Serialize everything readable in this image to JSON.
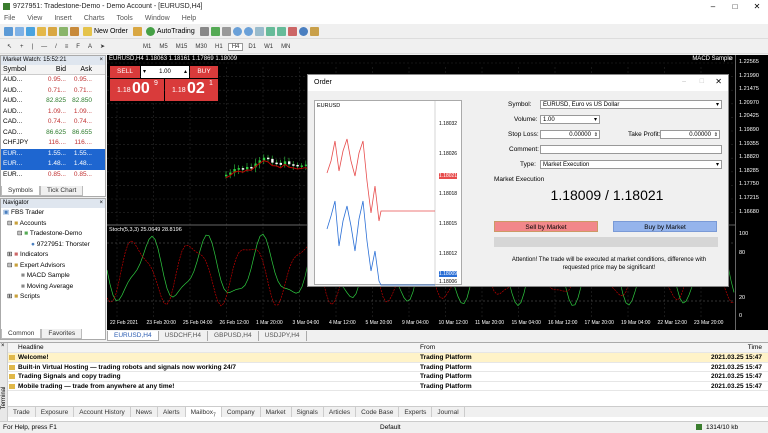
{
  "window": {
    "title": "9727951: Tradestone-Demo - Demo Account - [EURUSD,H4]"
  },
  "menu": [
    "File",
    "View",
    "Insert",
    "Charts",
    "Tools",
    "Window",
    "Help"
  ],
  "toolbar": {
    "new_order": "New Order",
    "autotrading": "AutoTrading",
    "timeframes": [
      "M1",
      "M5",
      "M15",
      "M30",
      "H1",
      "H4",
      "D1",
      "W1",
      "MN"
    ]
  },
  "market_watch": {
    "title": "Market Watch: 15:52:21",
    "headers": [
      "Symbol",
      "Bid",
      "Ask"
    ],
    "rows": [
      [
        "AUD...",
        "0.95...",
        "0.95..."
      ],
      [
        "AUD...",
        "0.71...",
        "0.71..."
      ],
      [
        "AUD...",
        "82.825",
        "82.850"
      ],
      [
        "AUD...",
        "1.09...",
        "1.09..."
      ],
      [
        "CAD...",
        "0.74...",
        "0.74..."
      ],
      [
        "CAD...",
        "86.625",
        "86.655"
      ],
      [
        "CHFJPY",
        "116....",
        "116...."
      ],
      [
        "EUR...",
        "1.55...",
        "1.55..."
      ],
      [
        "EUR...",
        "1.48...",
        "1.48..."
      ],
      [
        "EUR...",
        "0.85...",
        "0.85..."
      ]
    ],
    "tabs": [
      "Symbols",
      "Tick Chart"
    ]
  },
  "navigator": {
    "title": "Navigator",
    "items": [
      "FBS Trader",
      "Accounts",
      "Tradestone-Demo",
      "9727951: Thorster",
      "Indicators",
      "Expert Advisors",
      "MACD Sample",
      "Moving Average",
      "Scripts"
    ],
    "tabs": [
      "Common",
      "Favorites"
    ]
  },
  "chart": {
    "info": "EURUSD,H4 1.18063 1.18161 1.17869 1.18009",
    "sell": "SELL",
    "buy": "BUY",
    "lot": "1.00",
    "sell_price_a": "1.18",
    "sell_price_b": "00",
    "sell_price_c": "9",
    "buy_price_a": "1.18",
    "buy_price_b": "02",
    "buy_price_c": "1",
    "expert": "MACD Sample",
    "stoch": "Stoch(5,3,3) 25.0649 28.8196",
    "price_labels": [
      "1.22565",
      "1.21990",
      "1.21475",
      "1.20970",
      "1.20425",
      "1.19890",
      "1.19355",
      "1.18820",
      "1.18285",
      "1.17750",
      "1.17215",
      "1.16680"
    ],
    "stoch_labels": [
      "100",
      "80",
      "20",
      "0"
    ],
    "dates": [
      "22 Feb 2021",
      "23 Feb 20:00",
      "25 Feb 04:00",
      "26 Feb 12:00",
      "1 Mar 20:00",
      "3 Mar 04:00",
      "4 Mar 12:00",
      "5 Mar 20:00",
      "9 Mar 04:00",
      "10 Mar 12:00",
      "11 Mar 20:00",
      "15 Mar 04:00",
      "16 Mar 12:00",
      "17 Mar 20:00",
      "19 Mar 04:00",
      "22 Mar 12:00",
      "23 Mar 20:00"
    ],
    "tabs": [
      "EURUSD,H4",
      "USDCHF,H4",
      "GBPUSD,H4",
      "USDJPY,H4"
    ]
  },
  "order": {
    "title": "Order",
    "mini_symbol": "EURUSD",
    "mini_labels": [
      "1.18032",
      "1.18026",
      "1.18021",
      "1.18015",
      "1.18009",
      "1.18006"
    ],
    "mini_levels": [
      "1.18032",
      "1.18026",
      "1.18021",
      "1.18018",
      "1.18015",
      "1.18012",
      "1.18009",
      "1.18006"
    ],
    "fields": {
      "symbol_label": "Symbol:",
      "symbol": "EURUSD, Euro vs US Dollar",
      "volume_label": "Volume:",
      "volume": "1.00",
      "sl_label": "Stop Loss:",
      "sl": "0.00000",
      "tp_label": "Take Profit:",
      "tp": "0.00000",
      "comment_label": "Comment:",
      "type_label": "Type:",
      "type": "Market Execution"
    },
    "section": "Market Execution",
    "price_bid": "1.18009",
    "price_ask": "1.18021",
    "sell_btn": "Sell by Market",
    "buy_btn": "Buy by Market",
    "attention": "Attention! The trade will be executed at market conditions, difference with requested price may be significant!"
  },
  "terminal": {
    "headers": [
      "Headline",
      "From",
      "Time"
    ],
    "rows": [
      [
        "Welcome!",
        "Trading Platform",
        "2021.03.25 15:47"
      ],
      [
        "Built-in Virtual Hosting — trading robots and signals now working 24/7",
        "Trading Platform",
        "2021.03.25 15:47"
      ],
      [
        "Trading Signals and copy trading",
        "Trading Platform",
        "2021.03.25 15:47"
      ],
      [
        "Mobile trading — trade from anywhere at any time!",
        "Trading Platform",
        "2021.03.25 15:47"
      ]
    ],
    "side": "Terminal",
    "tabs": [
      "Trade",
      "Exposure",
      "Account History",
      "News",
      "Alerts",
      "Mailbox",
      "Company",
      "Market",
      "Signals",
      "Articles",
      "Code Base",
      "Experts",
      "Journal"
    ],
    "mailbox_badge": "7"
  },
  "status": {
    "help": "For Help, press F1",
    "profile": "Default",
    "traffic": "1314/10 kb"
  }
}
